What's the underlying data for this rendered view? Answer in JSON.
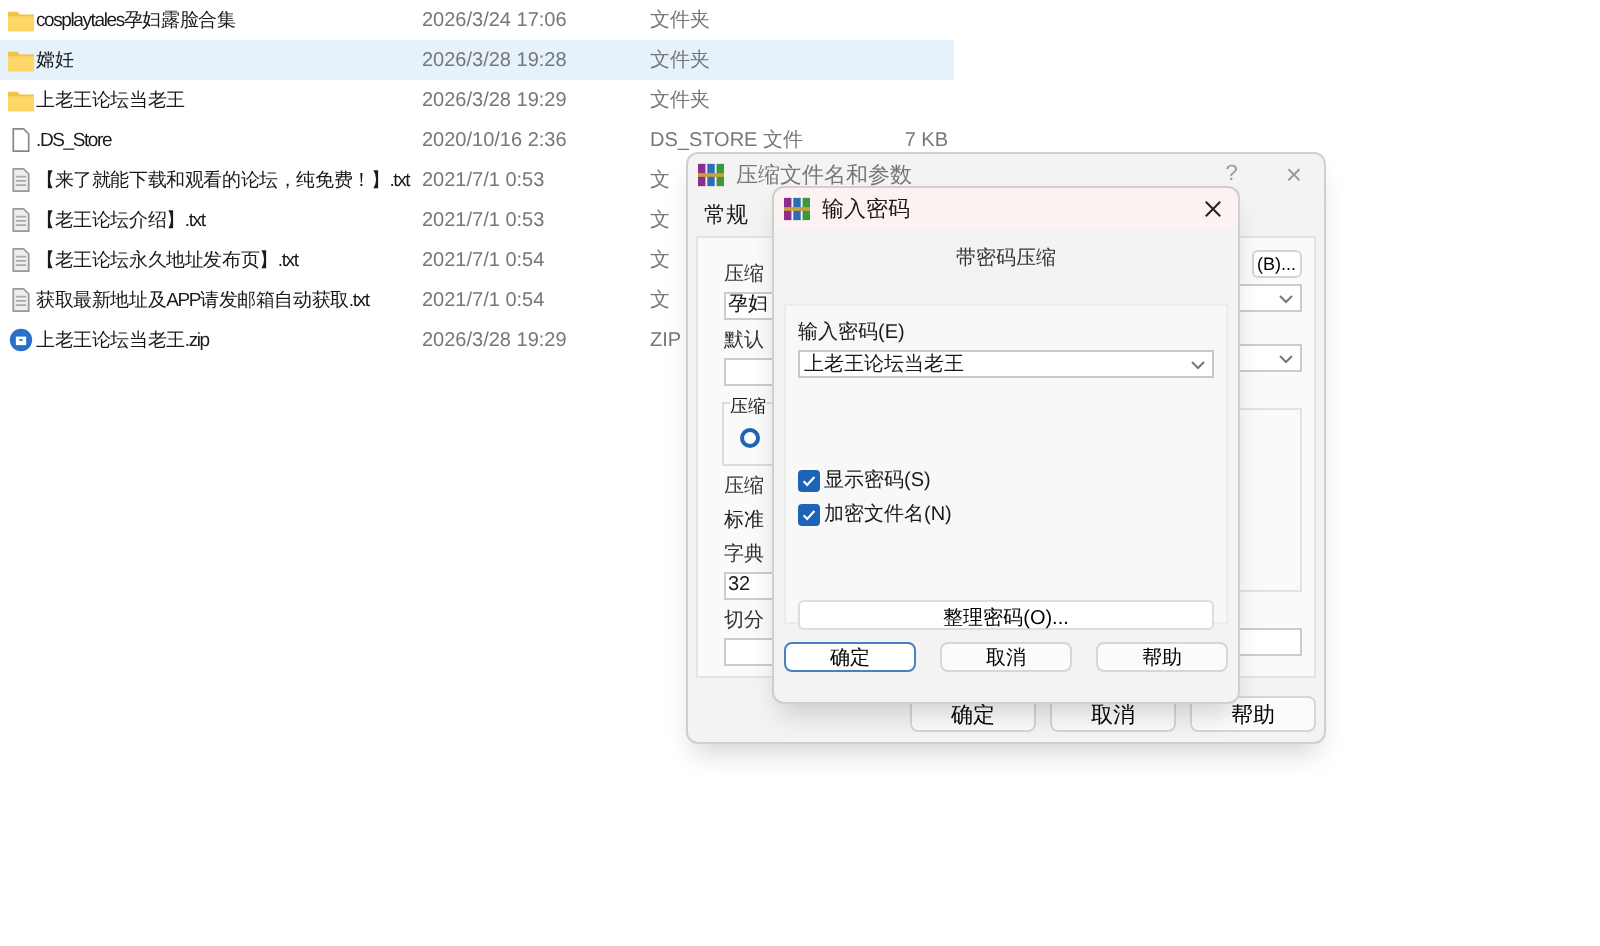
{
  "files": [
    {
      "name": "cosplaytales孕妇露脸合集",
      "date": "2026/3/24 17:06",
      "type": "文件夹",
      "kind": "folder",
      "selected": false
    },
    {
      "name": "嫦妊",
      "date": "2026/3/28 19:28",
      "type": "文件夹",
      "kind": "folder",
      "selected": true
    },
    {
      "name": "上老王论坛当老王",
      "date": "2026/3/28 19:29",
      "type": "文件夹",
      "kind": "folder",
      "selected": false
    },
    {
      "name": ".DS_Store",
      "date": "2020/10/16 2:36",
      "type": "DS_STORE 文件",
      "size": "7 KB",
      "kind": "file",
      "selected": false
    },
    {
      "name": "【来了就能下载和观看的论坛，纯免费！】.txt",
      "date": "2021/7/1 0:53",
      "type": "文",
      "kind": "text",
      "selected": false
    },
    {
      "name": "【老王论坛介绍】.txt",
      "date": "2021/7/1 0:53",
      "type": "文",
      "kind": "text",
      "selected": false
    },
    {
      "name": "【老王论坛永久地址发布页】.txt",
      "date": "2021/7/1 0:54",
      "type": "文",
      "kind": "text",
      "selected": false
    },
    {
      "name": "获取最新地址及APP请发邮箱自动获取.txt",
      "date": "2021/7/1 0:54",
      "type": "文",
      "kind": "text",
      "selected": false
    },
    {
      "name": "上老王论坛当老王.zip",
      "date": "2026/3/28 19:29",
      "type": "ZIP",
      "kind": "zip",
      "selected": false
    }
  ],
  "archive_dialog": {
    "title": "压缩文件名和参数",
    "help": "?",
    "close": "×",
    "tab": "常规",
    "left_labels": [
      {
        "kind": "label",
        "text": "压缩"
      },
      {
        "kind": "field",
        "text": "孕妇"
      },
      {
        "kind": "label",
        "text": "默认"
      },
      {
        "kind": "field"
      },
      {
        "kind": "group",
        "text": "压缩",
        "selected": true
      },
      {
        "kind": "label",
        "text": "压缩"
      },
      {
        "kind": "plain",
        "text": "标准"
      },
      {
        "kind": "label",
        "text": "字典"
      },
      {
        "kind": "field",
        "text": "32"
      },
      {
        "kind": "label",
        "text": "切分"
      },
      {
        "kind": "field"
      }
    ],
    "browse_button": "(B)...",
    "buttons": [
      "确定",
      "取消",
      "帮助"
    ]
  },
  "password_dialog": {
    "title": "输入密码",
    "heading": "带密码压缩",
    "password_label": "输入密码(E)",
    "password_value": "上老王论坛当老王",
    "options": [
      {
        "label": "显示密码(S)",
        "checked": true
      },
      {
        "label": "加密文件名(N)",
        "checked": true
      }
    ],
    "manage_button": "整理密码(O)...",
    "buttons": [
      {
        "label": "确定",
        "default": true
      },
      {
        "label": "取消",
        "default": false
      },
      {
        "label": "帮助",
        "default": false
      }
    ]
  }
}
